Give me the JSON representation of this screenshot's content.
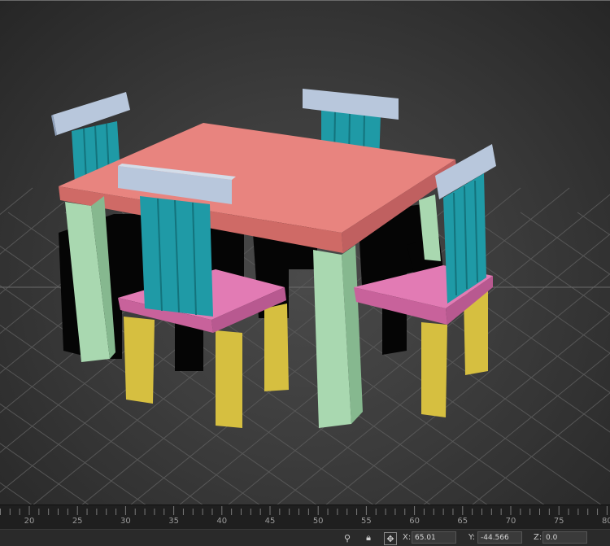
{
  "viewport": {
    "background": "#3a3a3a",
    "grid_color": "#5a5a5a",
    "object_colors": {
      "table_top": "#e8847f",
      "table_legs": "#a9d8b0",
      "chair_seat": "#e27bb4",
      "chair_legs": "#d6bf40",
      "chair_slats": "#1f9aa6",
      "chair_rail": "#b8c7dc"
    }
  },
  "timeline": {
    "ticks": [
      "20",
      "25",
      "30",
      "35",
      "40",
      "45",
      "50",
      "55",
      "60",
      "65",
      "70",
      "75",
      "80"
    ]
  },
  "statusbar": {
    "icons": [
      "key-icon",
      "lock-icon",
      "transform-mode-icon"
    ],
    "x_label": "X:",
    "x_value": "65.01",
    "y_label": "Y:",
    "y_value": "-44.566",
    "z_label": "Z:",
    "z_value": "0.0"
  }
}
